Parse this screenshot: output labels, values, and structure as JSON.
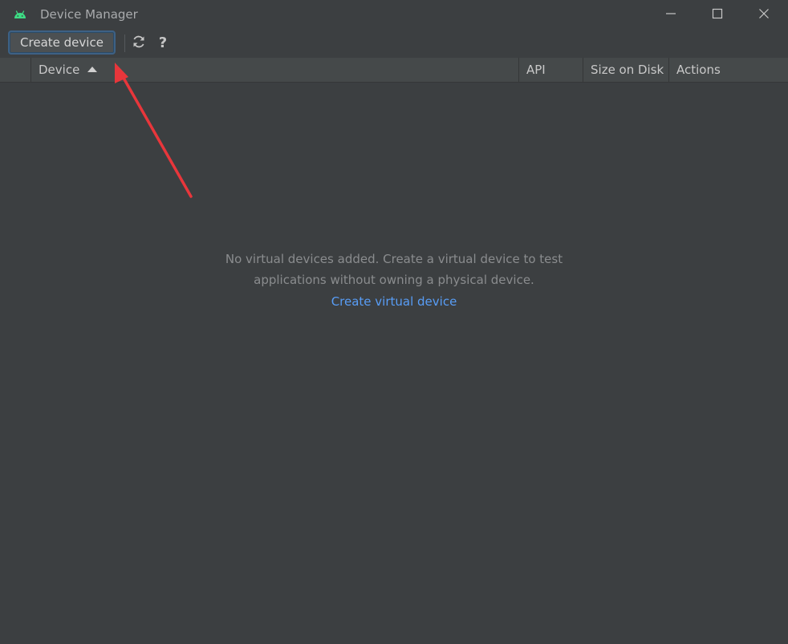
{
  "window": {
    "title": "Device Manager",
    "icon": "android-icon",
    "controls": {
      "minimize": "minimize-icon",
      "maximize": "maximize-icon",
      "close": "close-icon"
    }
  },
  "toolbar": {
    "create_label": "Create device",
    "refresh_icon": "refresh-icon",
    "help_label": "?"
  },
  "table": {
    "columns": [
      {
        "label": ""
      },
      {
        "label": "Device",
        "sorted": "ascending"
      },
      {
        "label": "API"
      },
      {
        "label": "Size on Disk"
      },
      {
        "label": "Actions"
      }
    ]
  },
  "empty_state": {
    "line1": "No virtual devices added. Create a virtual device to test",
    "line2": "applications without owning a physical device.",
    "link": "Create virtual device"
  },
  "colors": {
    "background": "#3c3f41",
    "header": "#45494a",
    "link": "#589df6",
    "android": "#3ddc84",
    "annotation": "#e8363b"
  }
}
